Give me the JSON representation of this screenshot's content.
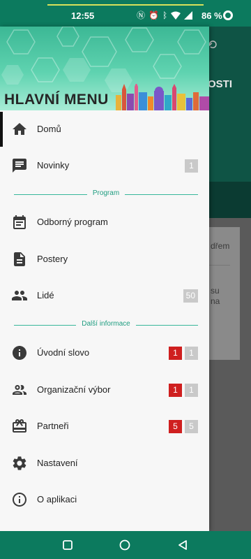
{
  "status_bar": {
    "time": "12:55",
    "battery": "86 %"
  },
  "background": {
    "header_title": "OSTI",
    "card_text_1": "dřem",
    "card_text_2": "su\nna"
  },
  "drawer": {
    "title": "HLAVNÍ MENU",
    "items": [
      {
        "label": "Domů",
        "icon": "home-icon"
      },
      {
        "label": "Novinky",
        "icon": "chat-icon",
        "badge_grey": "1"
      },
      {
        "label": "Odborný program",
        "icon": "calendar-icon"
      },
      {
        "label": "Postery",
        "icon": "document-icon"
      },
      {
        "label": "Lidé",
        "icon": "people-icon",
        "badge_grey": "50"
      },
      {
        "label": "Úvodní slovo",
        "icon": "info-icon",
        "badge_red": "1",
        "badge_grey": "1"
      },
      {
        "label": "Organizační výbor",
        "icon": "people-outline-icon",
        "badge_red": "1",
        "badge_grey": "1"
      },
      {
        "label": "Partneři",
        "icon": "gift-card-icon",
        "badge_red": "5",
        "badge_grey": "5"
      },
      {
        "label": "Nastavení",
        "icon": "gear-icon"
      },
      {
        "label": "O aplikaci",
        "icon": "info-outline-icon"
      }
    ],
    "sections": {
      "program": "Program",
      "more_info": "Další informace"
    }
  },
  "colors": {
    "primary": "#0c7a5e",
    "accent": "#37b79a",
    "badge_red": "#cf1f1f",
    "badge_grey": "#c9c9c9"
  }
}
